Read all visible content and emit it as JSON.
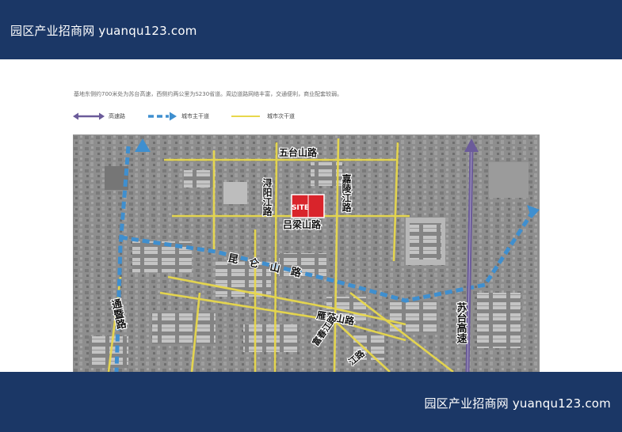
{
  "header": {
    "watermark": "园区产业招商网 yuanqu123.com"
  },
  "footer": {
    "watermark": "园区产业招商网 yuanqu123.com"
  },
  "caption": "基地东侧约700米处为苏台高速，西侧约两公里为S230省道。周边道路网络丰富，交通便利，商业配套较弱。",
  "legend": [
    {
      "label": "高速路",
      "color": "#6b5b9a"
    },
    {
      "label": "城市主干道",
      "color": "#3f8fcf"
    },
    {
      "label": "城市次干道",
      "color": "#e8d84c"
    }
  ],
  "map": {
    "site_label": "SITE",
    "site_color": "#d9242b",
    "roads": {
      "wutaishan": "五台山路",
      "xunyangjiang": "浔阳江路",
      "jialingjiang": "嘉陵江路",
      "lvliangshan": "吕梁山路",
      "kunlunshan": "昆仑山路",
      "yandangshan": "雁荡山路",
      "fuchunjiang": "富春江路",
      "tongyi": "通暨路",
      "sutai": "苏台高速",
      "lower_jiang": "江路"
    }
  }
}
